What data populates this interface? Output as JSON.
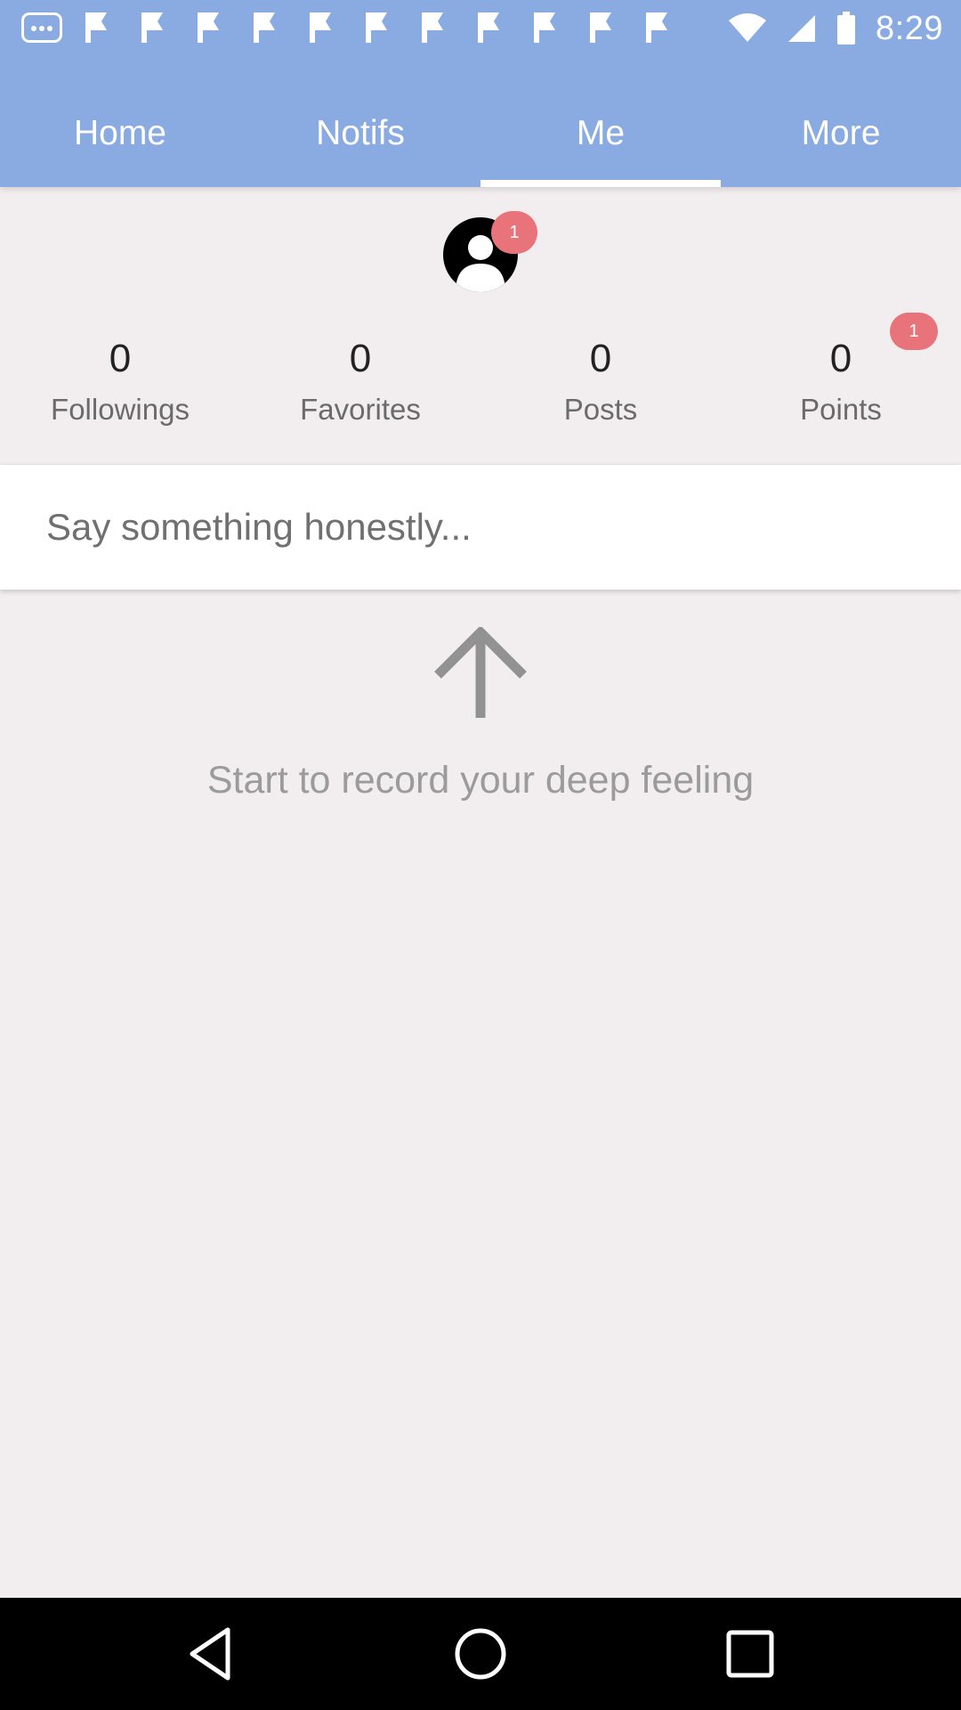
{
  "status_bar": {
    "time": "8:29",
    "notification_icons": [
      "more-notifications-icon",
      "flag-icon",
      "flag-icon",
      "flag-icon",
      "flag-icon",
      "flag-icon",
      "flag-icon",
      "flag-icon",
      "flag-icon",
      "flag-icon",
      "flag-icon",
      "flag-icon"
    ],
    "system_icons": [
      "wifi-icon",
      "signal-icon",
      "battery-icon"
    ]
  },
  "tabs": [
    {
      "label": "Home",
      "active": false
    },
    {
      "label": "Notifs",
      "active": false
    },
    {
      "label": "Me",
      "active": true
    },
    {
      "label": "More",
      "active": false
    }
  ],
  "profile": {
    "avatar_icon": "user-avatar-icon",
    "avatar_badge": "1",
    "stats": [
      {
        "count": "0",
        "label": "Followings"
      },
      {
        "count": "0",
        "label": "Favorites"
      },
      {
        "count": "0",
        "label": "Posts"
      },
      {
        "count": "0",
        "label": "Points",
        "badge": "1"
      }
    ]
  },
  "compose": {
    "placeholder": "Say something honestly...",
    "value": ""
  },
  "empty_state": {
    "icon": "arrow-up-icon",
    "text": "Start to record your deep feeling"
  },
  "nav_bar": {
    "buttons": [
      "back-icon",
      "home-icon",
      "recents-icon"
    ]
  },
  "colors": {
    "header": "#8aabe2",
    "background": "#f2eeef",
    "badge": "#e8737a",
    "nav_bar": "#000000"
  }
}
